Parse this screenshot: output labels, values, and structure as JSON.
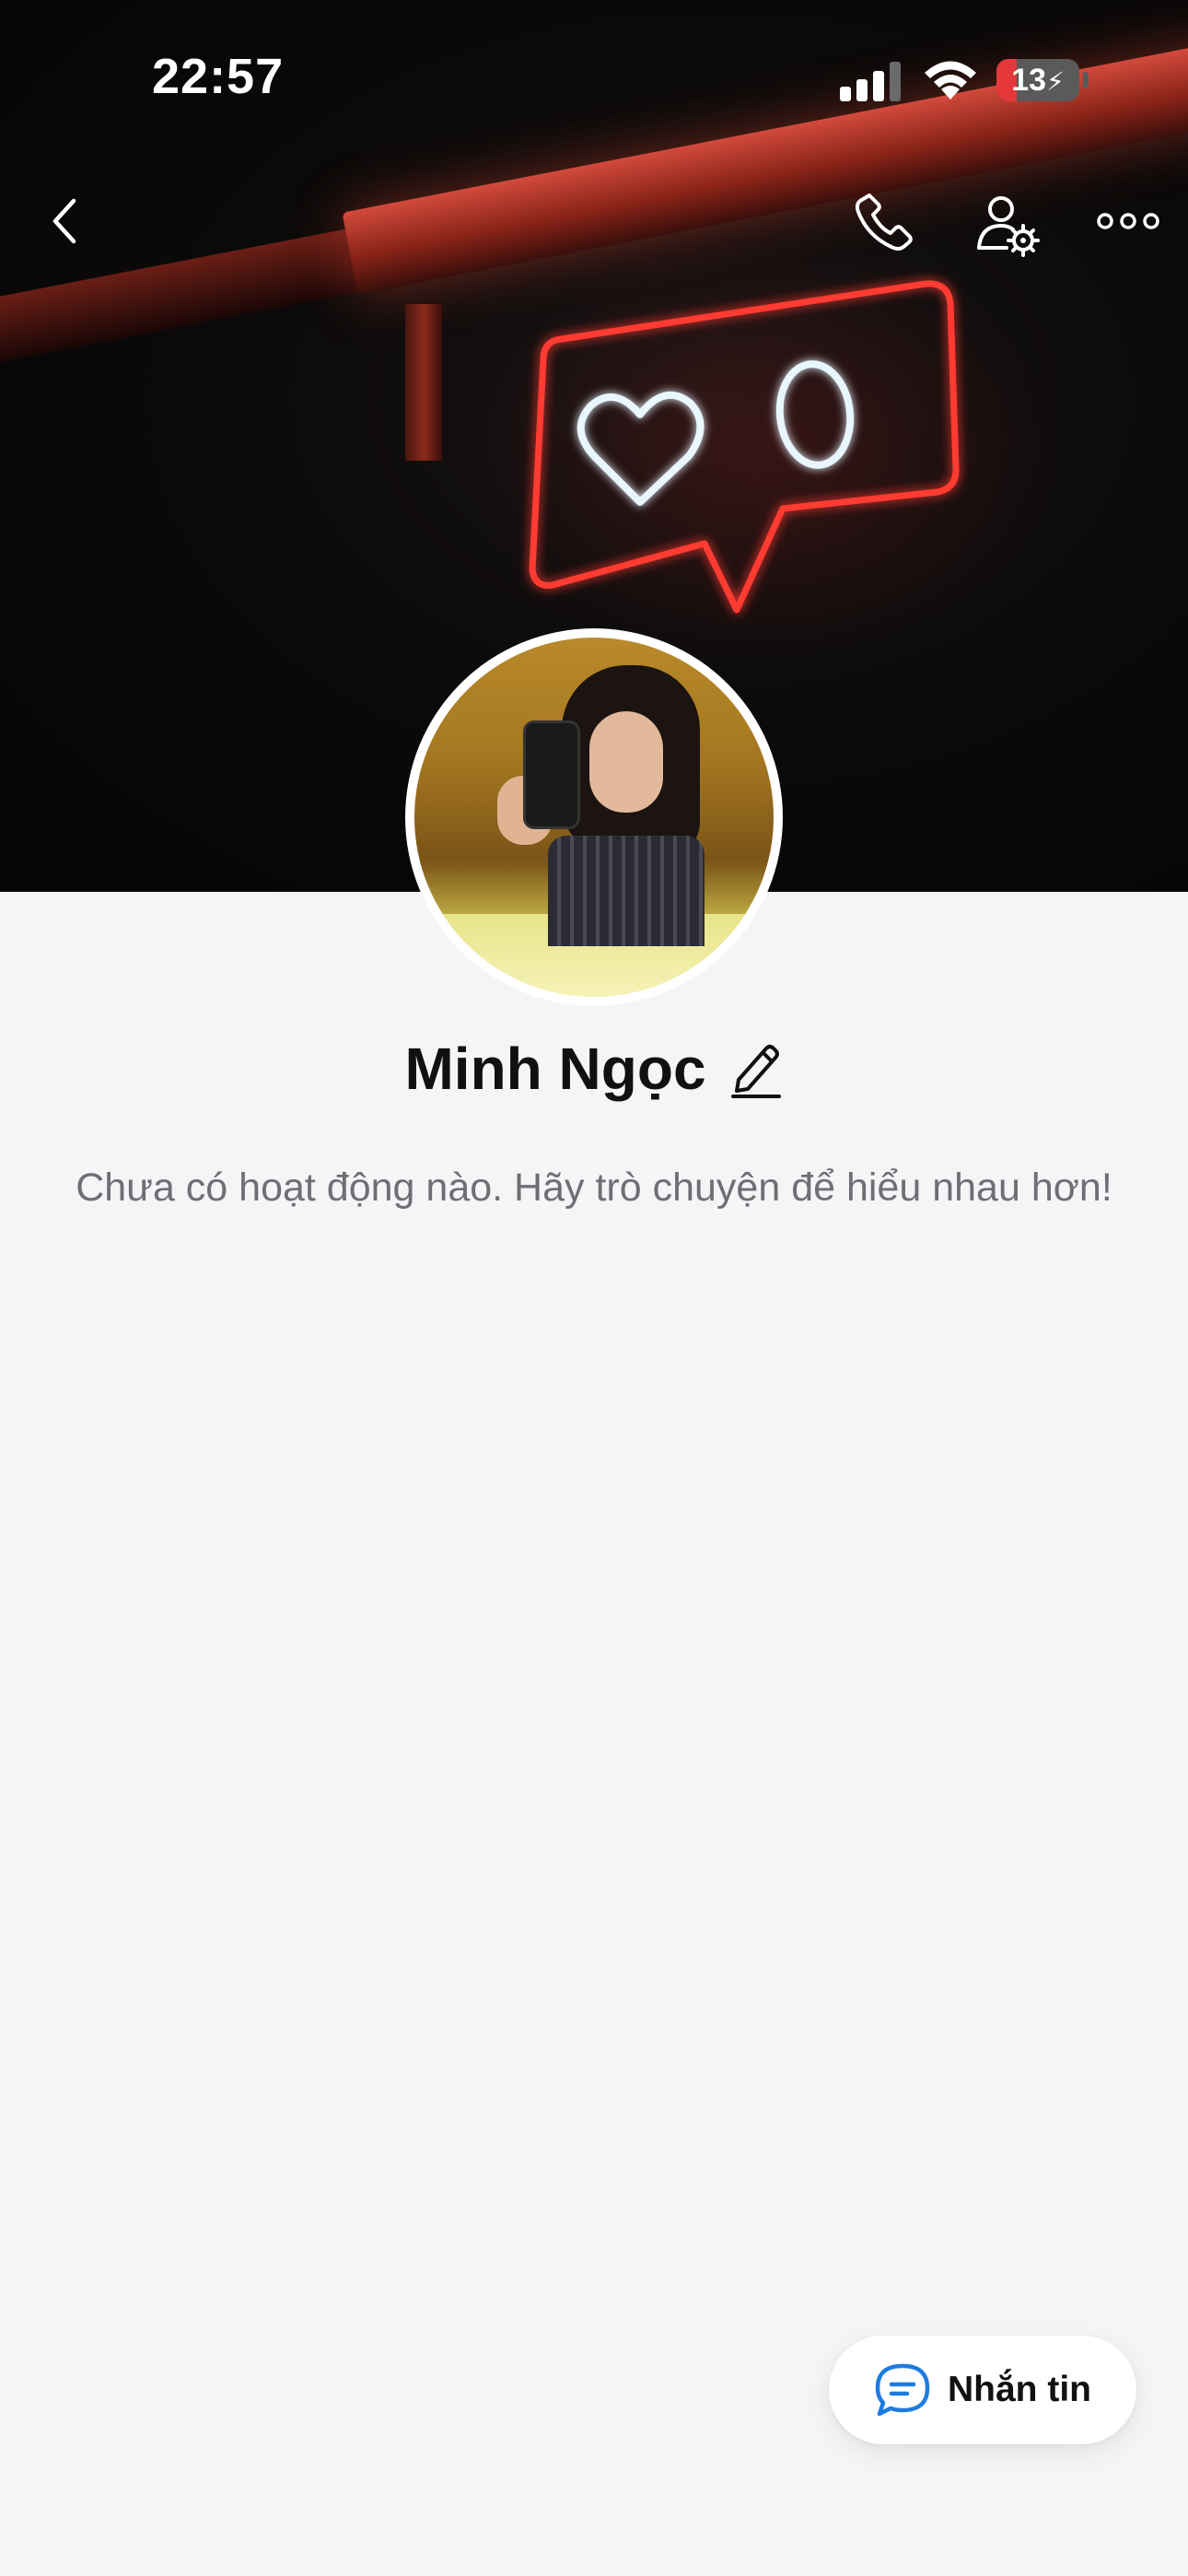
{
  "status_bar": {
    "time": "22:57",
    "battery_level": "13",
    "battery_fraction": 0.13,
    "signal_bars_active": 3,
    "signal_bars_total": 4,
    "charging": true
  },
  "nav": {
    "back_icon": "chevron-left-icon",
    "call_icon": "phone-icon",
    "settings_icon": "user-settings-icon",
    "more_icon": "more-horizontal-icon"
  },
  "profile": {
    "name": "Minh Ngọc",
    "edit_icon": "pencil-icon",
    "empty_message": "Chưa có hoạt động nào. Hãy trò chuyện để hiểu nhau hơn!"
  },
  "fab": {
    "label": "Nhắn tin",
    "icon": "chat-bubble-icon",
    "icon_color": "#1e7ce0"
  },
  "colors": {
    "page_bg": "#f4f5f7",
    "neon_red": "#ff3b30",
    "neon_white": "#e8f6ff",
    "battery_red": "#e5383b"
  }
}
